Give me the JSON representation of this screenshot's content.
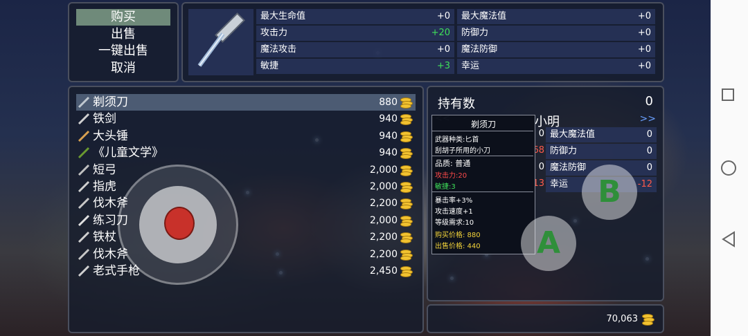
{
  "menu": {
    "buy": "购买",
    "sell": "出售",
    "sell_all": "一键出售",
    "cancel": "取消"
  },
  "item_stats": [
    {
      "label": "最大生命值",
      "value": "+0"
    },
    {
      "label": "最大魔法值",
      "value": "+0"
    },
    {
      "label": "攻击力",
      "value": "+20",
      "color": "#3fe05a"
    },
    {
      "label": "防御力",
      "value": "+0"
    },
    {
      "label": "魔法攻击",
      "value": "+0"
    },
    {
      "label": "魔法防御",
      "value": "+0"
    },
    {
      "label": "敏捷",
      "value": "+3",
      "color": "#3fe05a"
    },
    {
      "label": "幸运",
      "value": "+0"
    }
  ],
  "items": [
    {
      "name": "剃须刀",
      "price": "880"
    },
    {
      "name": "铁剑",
      "price": "940"
    },
    {
      "name": "大头锤",
      "price": "940"
    },
    {
      "name": "《儿童文学》",
      "price": "940"
    },
    {
      "name": "短弓",
      "price": "2,000"
    },
    {
      "name": "指虎",
      "price": "2,000"
    },
    {
      "name": "伐木斧",
      "price": "2,200"
    },
    {
      "name": "练习刀",
      "price": "2,000"
    },
    {
      "name": "铁杖",
      "price": "2,200"
    },
    {
      "name": "伐木斧",
      "price": "2,200"
    },
    {
      "name": "老式手枪",
      "price": "2,450"
    }
  ],
  "owned": {
    "label": "持有数",
    "count": "0",
    "char_name": "小明",
    "nav_prev": "<<",
    "nav_next": ">>",
    "stats": [
      {
        "label": "最大魔法值",
        "value": "0",
        "left": "0"
      },
      {
        "label": "防御力",
        "value": "0",
        "left": "68"
      },
      {
        "label": "魔法防御",
        "value": "0",
        "left": "0"
      },
      {
        "label": "幸运",
        "value": "-12",
        "left": "13"
      }
    ]
  },
  "tooltip": {
    "title": "剃须刀",
    "type": "武器种类:匕首",
    "desc": "刮胡子所用的小刀",
    "quality": "品质: 普通",
    "atk": "攻击力:20",
    "agi": "敏捷:3",
    "crit": "暴击率+3%",
    "speed": "攻击速度+1",
    "level": "等级需求:10",
    "buy_price": "购买价格: 880",
    "sell_price": "出售价格: 440"
  },
  "gold": "70,063",
  "buttons": {
    "a": "A",
    "b": "B"
  }
}
